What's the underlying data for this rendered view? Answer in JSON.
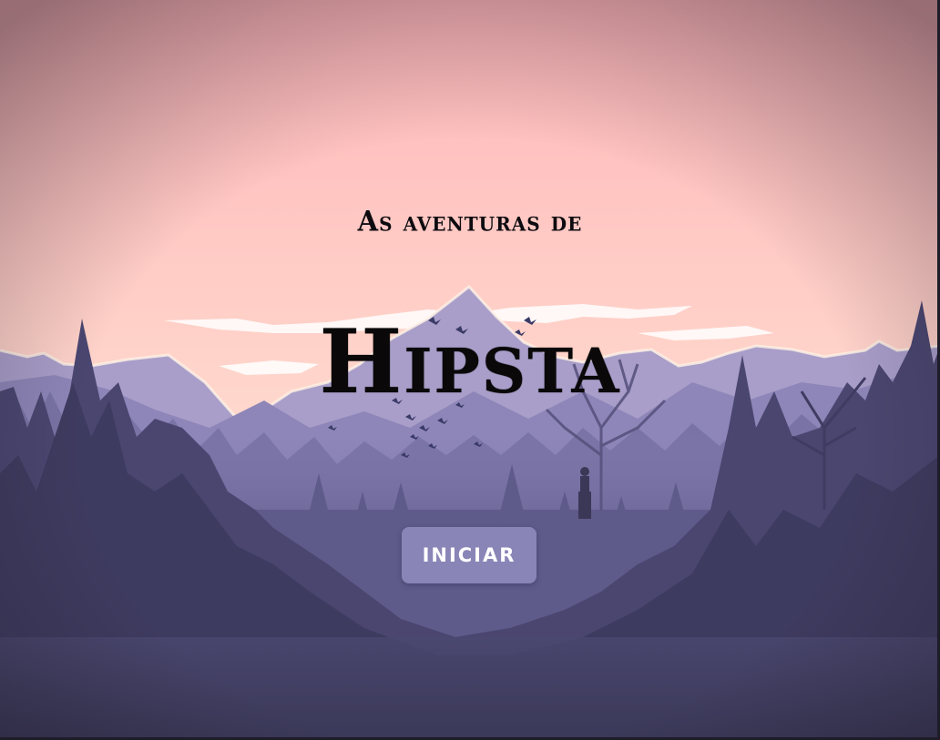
{
  "game": {
    "subtitle": "As aventuras de",
    "title": "Hipsta",
    "start_button_label": "INICIAR"
  },
  "colors": {
    "sky_top": "#ffb6b9",
    "sky_horizon": "#ffe0cf",
    "mountains_far": "#a99ec9",
    "forest_mid": "#6f6a9a",
    "forest_dark": "#3b3857",
    "button_bg": "#8a85b7",
    "button_text": "#ffffff",
    "title_text": "#0a0809"
  },
  "icons": {
    "birds": "bird-flock-icon",
    "wanderer": "wanderer-silhouette-icon"
  }
}
